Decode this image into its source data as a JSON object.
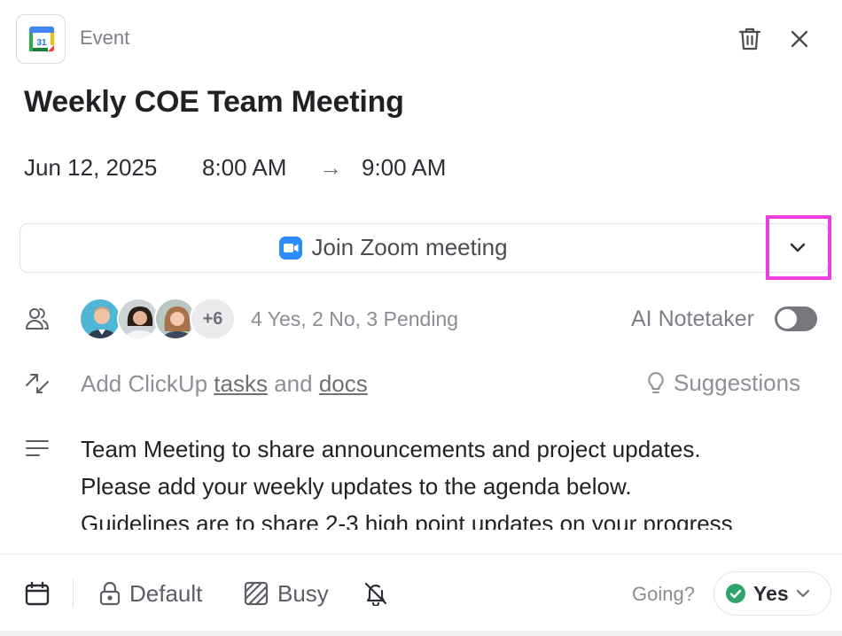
{
  "header": {
    "type_label": "Event",
    "app_icon": "google-calendar-icon",
    "app_icon_day": "31",
    "delete_icon": "trash-icon",
    "close_icon": "close-icon"
  },
  "event": {
    "title": "Weekly COE Team Meeting",
    "date": "Jun 12, 2025",
    "start_time": "8:00 AM",
    "arrow": "→",
    "end_time": "9:00 AM"
  },
  "zoom": {
    "label": "Join Zoom meeting",
    "icon": "zoom-icon",
    "dropdown_icon": "chevron-down-icon",
    "brand_color": "#2d8cff"
  },
  "attendees": {
    "icon": "people-icon",
    "extra_count": "+6",
    "rsvp_summary": "4 Yes, 2 No, 3 Pending",
    "avatars": [
      "avatar-1",
      "avatar-2",
      "avatar-3"
    ]
  },
  "ai_notetaker": {
    "label": "AI Notetaker",
    "enabled": false
  },
  "clickup": {
    "icon": "link-arrows-icon",
    "prefix": "Add ClickUp",
    "tasks_link": "tasks",
    "conjunction": "and",
    "docs_link": "docs",
    "suggestions_label": "Suggestions",
    "suggestions_icon": "lightbulb-icon"
  },
  "description": {
    "icon": "text-lines-icon",
    "lines": [
      "Team Meeting to share announcements and project updates.",
      "Please add your weekly updates to the agenda below.",
      "Guidelines are to share 2-3 high point updates on your progress"
    ]
  },
  "footer": {
    "calendar_icon": "calendar-icon",
    "visibility_label": "Default",
    "visibility_icon": "lock-icon",
    "availability_label": "Busy",
    "availability_icon": "hatched-square-icon",
    "notification_icon": "bell-off-icon",
    "going_label": "Going?",
    "response_label": "Yes",
    "response_icon": "check-circle-icon",
    "response_color": "#2ea66b"
  }
}
